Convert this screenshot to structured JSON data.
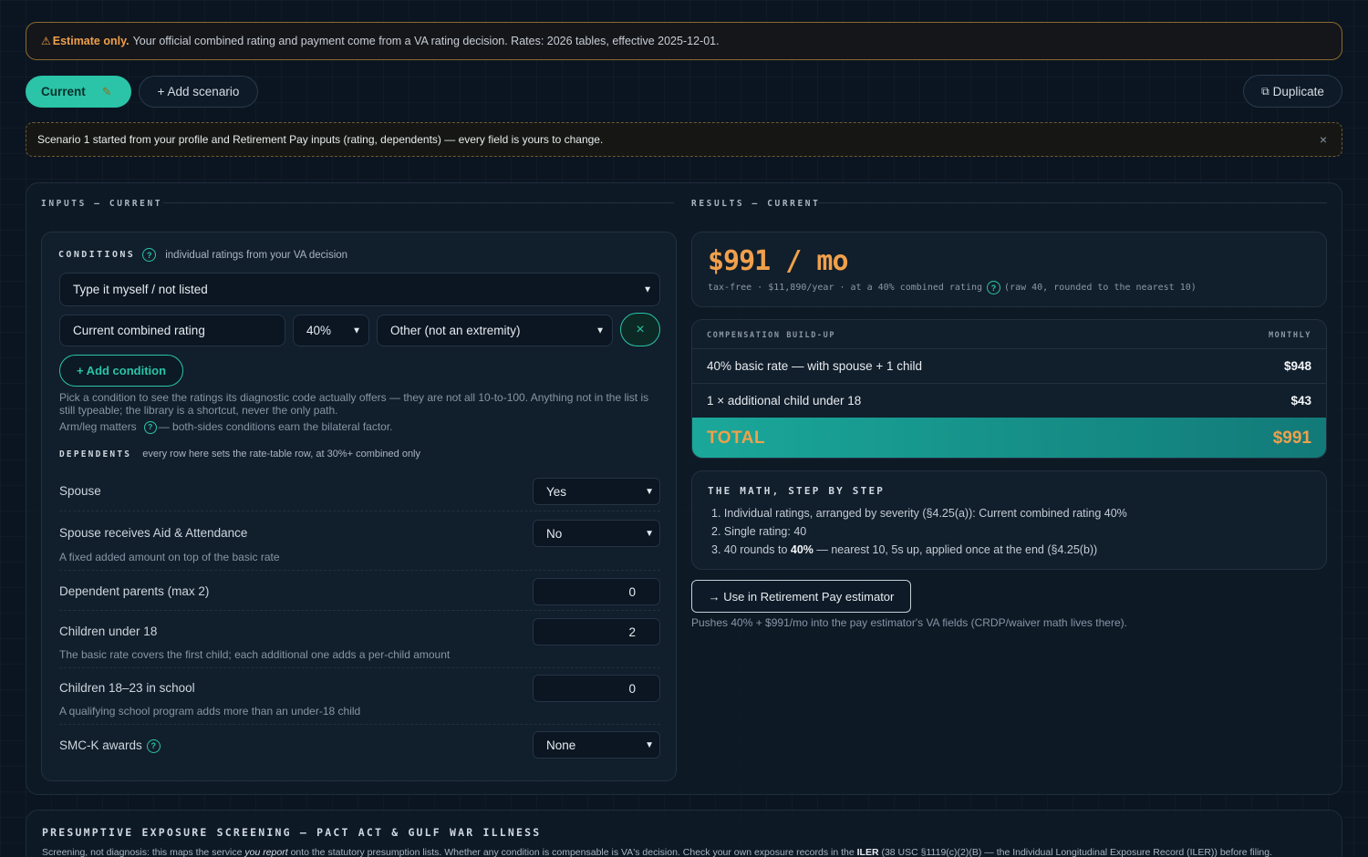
{
  "banner": {
    "icon": "warning-icon",
    "strong": "Estimate only.",
    "text": "Your official combined rating and payment come from a VA rating decision. Rates: 2026 tables, effective 2025-12-01."
  },
  "tabs": {
    "current_label": "Current",
    "edit_icon": "pencil-icon",
    "add_label": "+ Add scenario",
    "duplicate_label": "Duplicate"
  },
  "scenario_note": {
    "text": "Scenario 1 started from your profile and Retirement Pay inputs (rating, dependents) — every field is yours to change.",
    "close": "×"
  },
  "inputs": {
    "heading": "INPUTS — CURRENT",
    "conditions": {
      "label": "CONDITIONS",
      "help": "?",
      "hint": "individual ratings from your VA decision",
      "condition_select": "Type it myself / not listed",
      "name_value": "Current combined rating",
      "rating_value": "40%",
      "extremity_value": "Other (not an extremity)",
      "remove": "×",
      "add_label": "+ Add condition",
      "help_text_1": "Pick a condition to see the ratings its diagnostic code actually offers — they are not all 10-to-100. Anything not in the list is still typeable; the library is a shortcut, never the only path.",
      "help_text_2_prefix": "Arm/leg matters",
      "help_text_2_suffix": "— both-sides conditions earn the bilateral factor."
    },
    "dependents": {
      "label": "DEPENDENTS",
      "hint": "every row here sets the rate-table row, at 30%+ combined only",
      "rows": [
        {
          "label": "Spouse",
          "value": "Yes",
          "sub": ""
        },
        {
          "label": "Spouse receives Aid & Attendance",
          "value": "No",
          "sub": "A fixed added amount on top of the basic rate"
        },
        {
          "label": "Dependent parents (max 2)",
          "value": "0",
          "sub": ""
        },
        {
          "label": "Children under 18",
          "value": "2",
          "sub": "The basic rate covers the first child; each additional one adds a per-child amount"
        },
        {
          "label": "Children 18–23 in school",
          "value": "0",
          "sub": "A qualifying school program adds more than an under-18 child"
        },
        {
          "label": "SMC-K awards",
          "value": "None",
          "sub": ""
        }
      ]
    }
  },
  "results": {
    "heading": "RESULTS — CURRENT",
    "amount": "$991 / mo",
    "sub_prefix": "tax-free · $11,890/year · at a 40% combined rating",
    "sub_suffix": "(raw 40, rounded to the nearest 10)",
    "build_up": {
      "label": "COMPENSATION BUILD-UP",
      "col": "MONTHLY",
      "rows": [
        {
          "label": "40% basic rate — with spouse + 1 child",
          "value": "$948"
        },
        {
          "label": "1 × additional child under 18",
          "value": "$43"
        }
      ],
      "total_label": "TOTAL",
      "total_value": "$991"
    },
    "math": {
      "heading": "THE MATH, STEP BY STEP",
      "step1": "1. Individual ratings, arranged by severity (§4.25(a)): Current combined rating 40%",
      "step2": "2. Single rating: 40",
      "step3_a": "3. 40 rounds to ",
      "step3_b": "40%",
      "step3_c": " — nearest 10, 5s up, applied once at the end (§4.25(b))"
    },
    "use_button": "→ Use in Retirement Pay estimator",
    "use_note": "Pushes 40% + $991/mo into the pay estimator's VA fields (CRDP/waiver math lives there)."
  },
  "exposure": {
    "heading": "PRESUMPTIVE EXPOSURE SCREENING — PACT ACT & GULF WAR ILLNESS",
    "text_a": "Screening, not diagnosis: this maps the service ",
    "text_i": "you report",
    "text_b": " onto the statutory presumption lists. Whether any condition is compensable is VA's decision. Check your own exposure records in the ",
    "text_bold": "ILER",
    "text_c": " (38 USC §1119(c)(2)(B) — the Individual Longitudinal Exposure Record (ILER)) before filing."
  },
  "colors": {
    "accent": "#2bc4a8",
    "amount": "#f0a04b",
    "background": "#0b1521"
  }
}
